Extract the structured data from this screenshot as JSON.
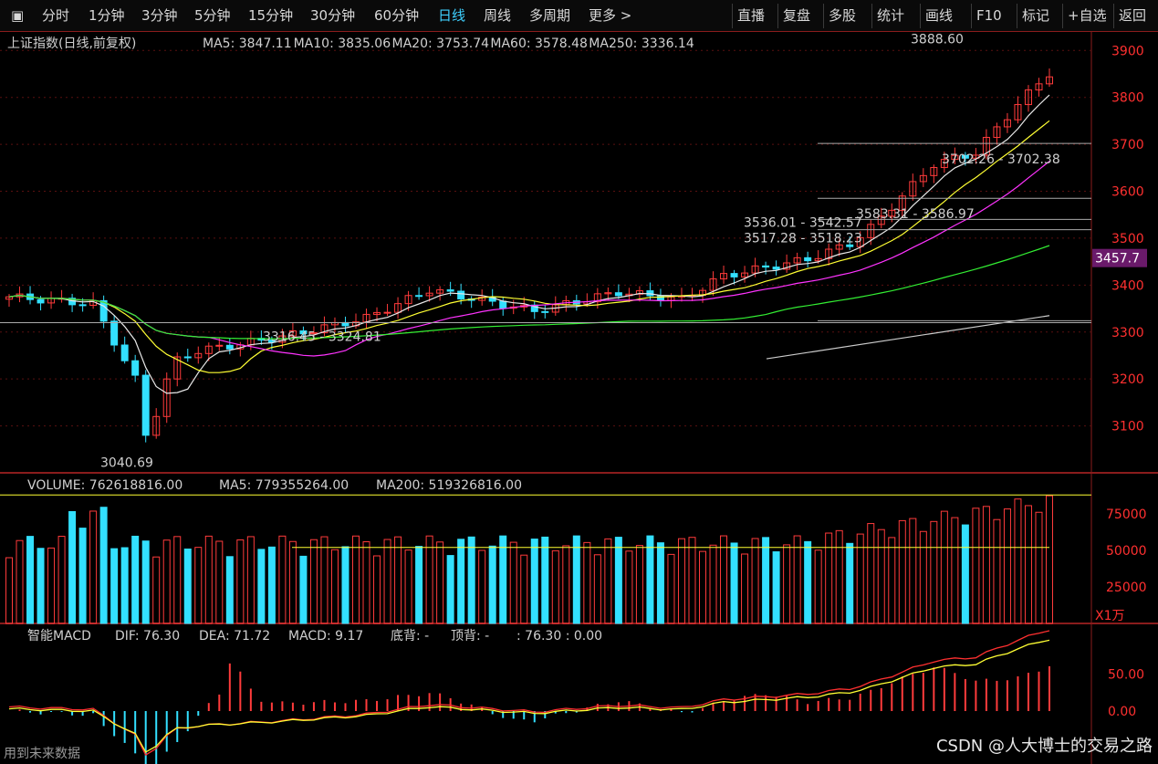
{
  "toolbar": {
    "left": [
      "分时",
      "1分钟",
      "3分钟",
      "5分钟",
      "15分钟",
      "30分钟",
      "60分钟",
      "日线",
      "周线",
      "多周期",
      "更多 >"
    ],
    "active": "日线",
    "right": [
      "直播",
      "复盘",
      "多股",
      "统计",
      "画线",
      "F10",
      "标记",
      "+自选",
      "返回"
    ]
  },
  "price_panel": {
    "title": "上证指数(日线,前复权)",
    "ma": [
      {
        "name": "MA5",
        "value": "3847.11",
        "color": "#e8e8e8"
      },
      {
        "name": "MA10",
        "value": "3835.06",
        "color": "#ffff33"
      },
      {
        "name": "MA20",
        "value": "3753.74",
        "color": "#ff33ff"
      },
      {
        "name": "MA60",
        "value": "3578.48",
        "color": "#33ee33"
      },
      {
        "name": "MA250",
        "value": "3336.14",
        "color": "#cccccc"
      }
    ],
    "current_price_tag": "3457.7",
    "annotations": [
      "3888.60",
      "3040.69",
      "3316.45 - 3324.81",
      "3583.31 - 3586.97",
      "3702.26 - 3702.38",
      "3536.01 - 3542.57",
      "3517.28 - 3518.23"
    ]
  },
  "volume_panel": {
    "title": "VOLUME: 762618816.00",
    "ma5": "MA5: 779355264.00",
    "ma200": "MA200: 519326816.00",
    "unit": "X1万"
  },
  "macd_panel": {
    "title": "智能MACD",
    "dif": "DIF: 76.30",
    "dea": "DEA: 71.72",
    "macd": "MACD: 9.17",
    "bottom": "底背: -",
    "top": "顶背: -",
    "extra": ": 76.30 : 0.00"
  },
  "footer": {
    "left": "用到未来数据",
    "watermark": "CSDN @人大博士的交易之路"
  },
  "chart_data": [
    {
      "type": "candlestick",
      "title": "上证指数(日线,前复权)",
      "y_ticks": [
        3100,
        3200,
        3300,
        3400,
        3500,
        3600,
        3700,
        3800,
        3900
      ],
      "ylim": [
        3000,
        3920
      ],
      "candles_count": 100,
      "low": 3040.69,
      "high": 3888.6
    },
    {
      "type": "bar",
      "title": "VOLUME",
      "y_ticks": [
        25000,
        50000,
        75000
      ],
      "unit": "X1万"
    },
    {
      "type": "bar",
      "title": "智能MACD",
      "y_ticks": [
        "0.00",
        "50.00"
      ]
    }
  ]
}
